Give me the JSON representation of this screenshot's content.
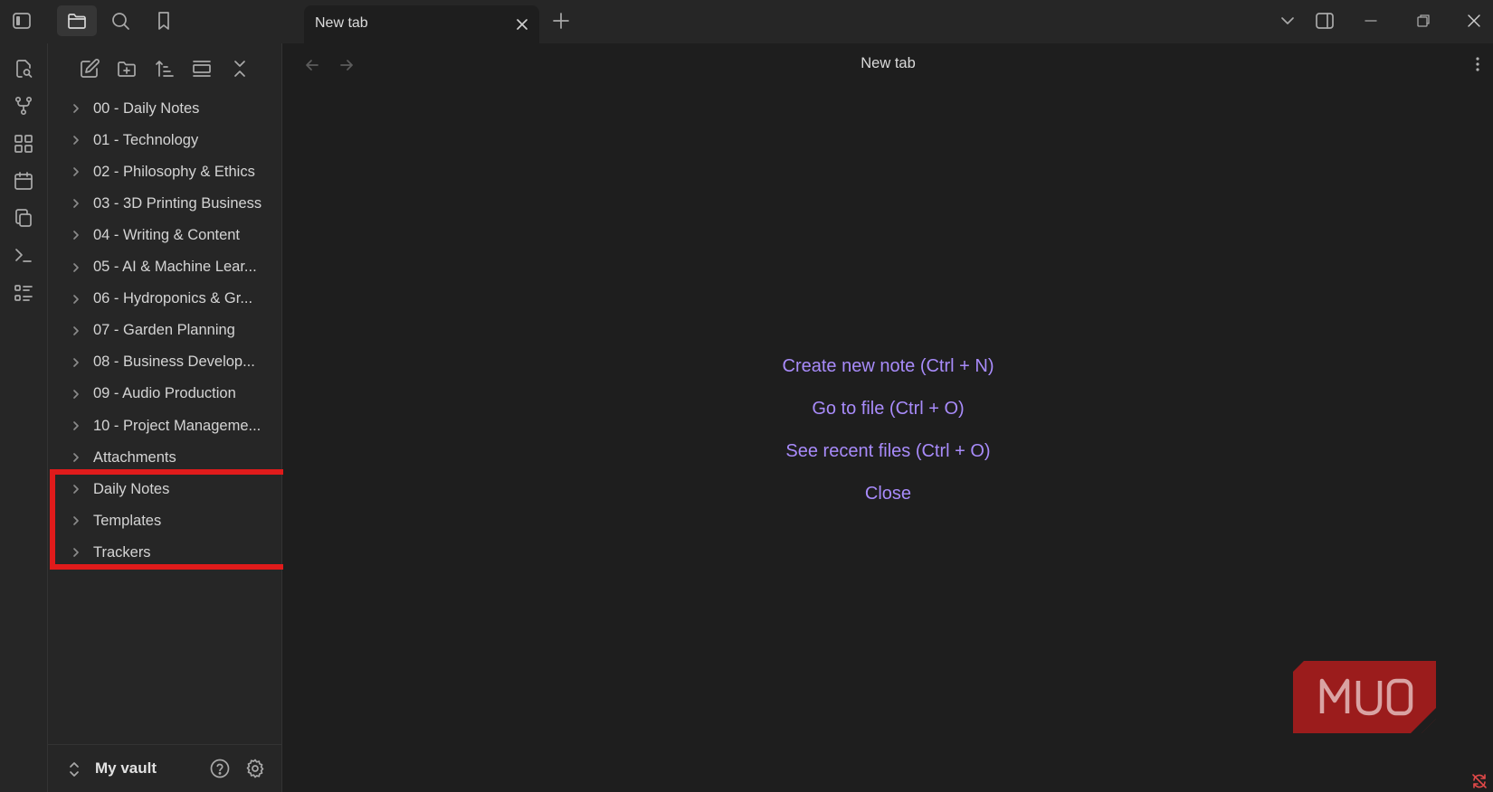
{
  "tab": {
    "title": "New tab"
  },
  "sidebar": {
    "folders": [
      {
        "label": "00 - Daily Notes"
      },
      {
        "label": "01 - Technology"
      },
      {
        "label": "02 - Philosophy & Ethics"
      },
      {
        "label": "03 - 3D Printing Business"
      },
      {
        "label": "04 - Writing & Content"
      },
      {
        "label": "05 - AI & Machine Lear..."
      },
      {
        "label": "06 - Hydroponics & Gr..."
      },
      {
        "label": "07 - Garden Planning"
      },
      {
        "label": "08 - Business Develop..."
      },
      {
        "label": "09 - Audio Production"
      },
      {
        "label": "10 - Project Manageme..."
      },
      {
        "label": "Attachments"
      },
      {
        "label": "Daily Notes"
      },
      {
        "label": "Templates"
      },
      {
        "label": "Trackers"
      }
    ],
    "vault_name": "My vault"
  },
  "main": {
    "view_title": "New tab",
    "actions": {
      "create": "Create new note (Ctrl + N)",
      "goto": "Go to file (Ctrl + O)",
      "recent": "See recent files (Ctrl + O)",
      "close": "Close"
    }
  },
  "watermark": {
    "text": "MUO"
  },
  "colors": {
    "accent": "#a88bfa",
    "highlight": "#e01b1b",
    "background": "#1e1e1e",
    "panel": "#262626"
  }
}
